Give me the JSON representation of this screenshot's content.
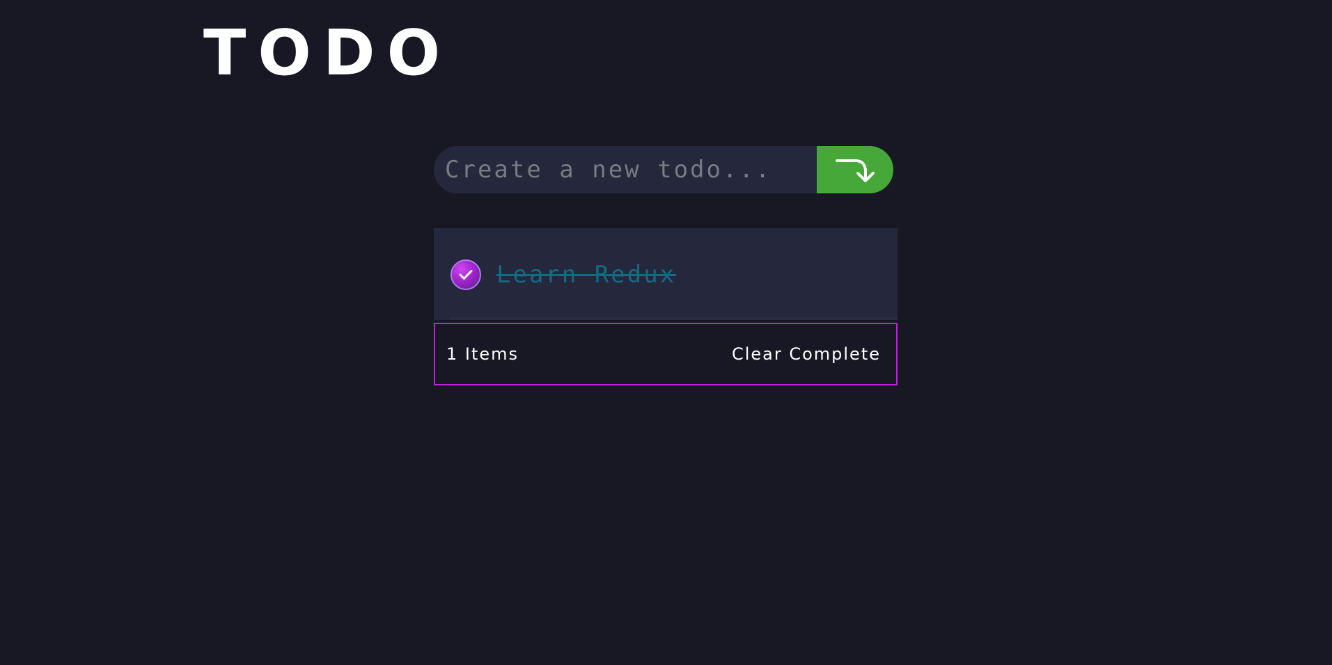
{
  "app": {
    "title": "TODO"
  },
  "new_todo": {
    "placeholder": "Create a new todo...",
    "value": "",
    "submit_icon": "arrow-turn-down-right-icon"
  },
  "todos": [
    {
      "text": "Learn Redux",
      "completed": true,
      "check_icon": "checkmark-icon"
    }
  ],
  "footer": {
    "items_count": "1 Items",
    "clear_label": "Clear Complete"
  },
  "colors": {
    "background": "#181824",
    "surface": "#25273c",
    "accent_green": "#45a838",
    "accent_purple": "#c41fe0",
    "completed_text": "#136b82"
  }
}
